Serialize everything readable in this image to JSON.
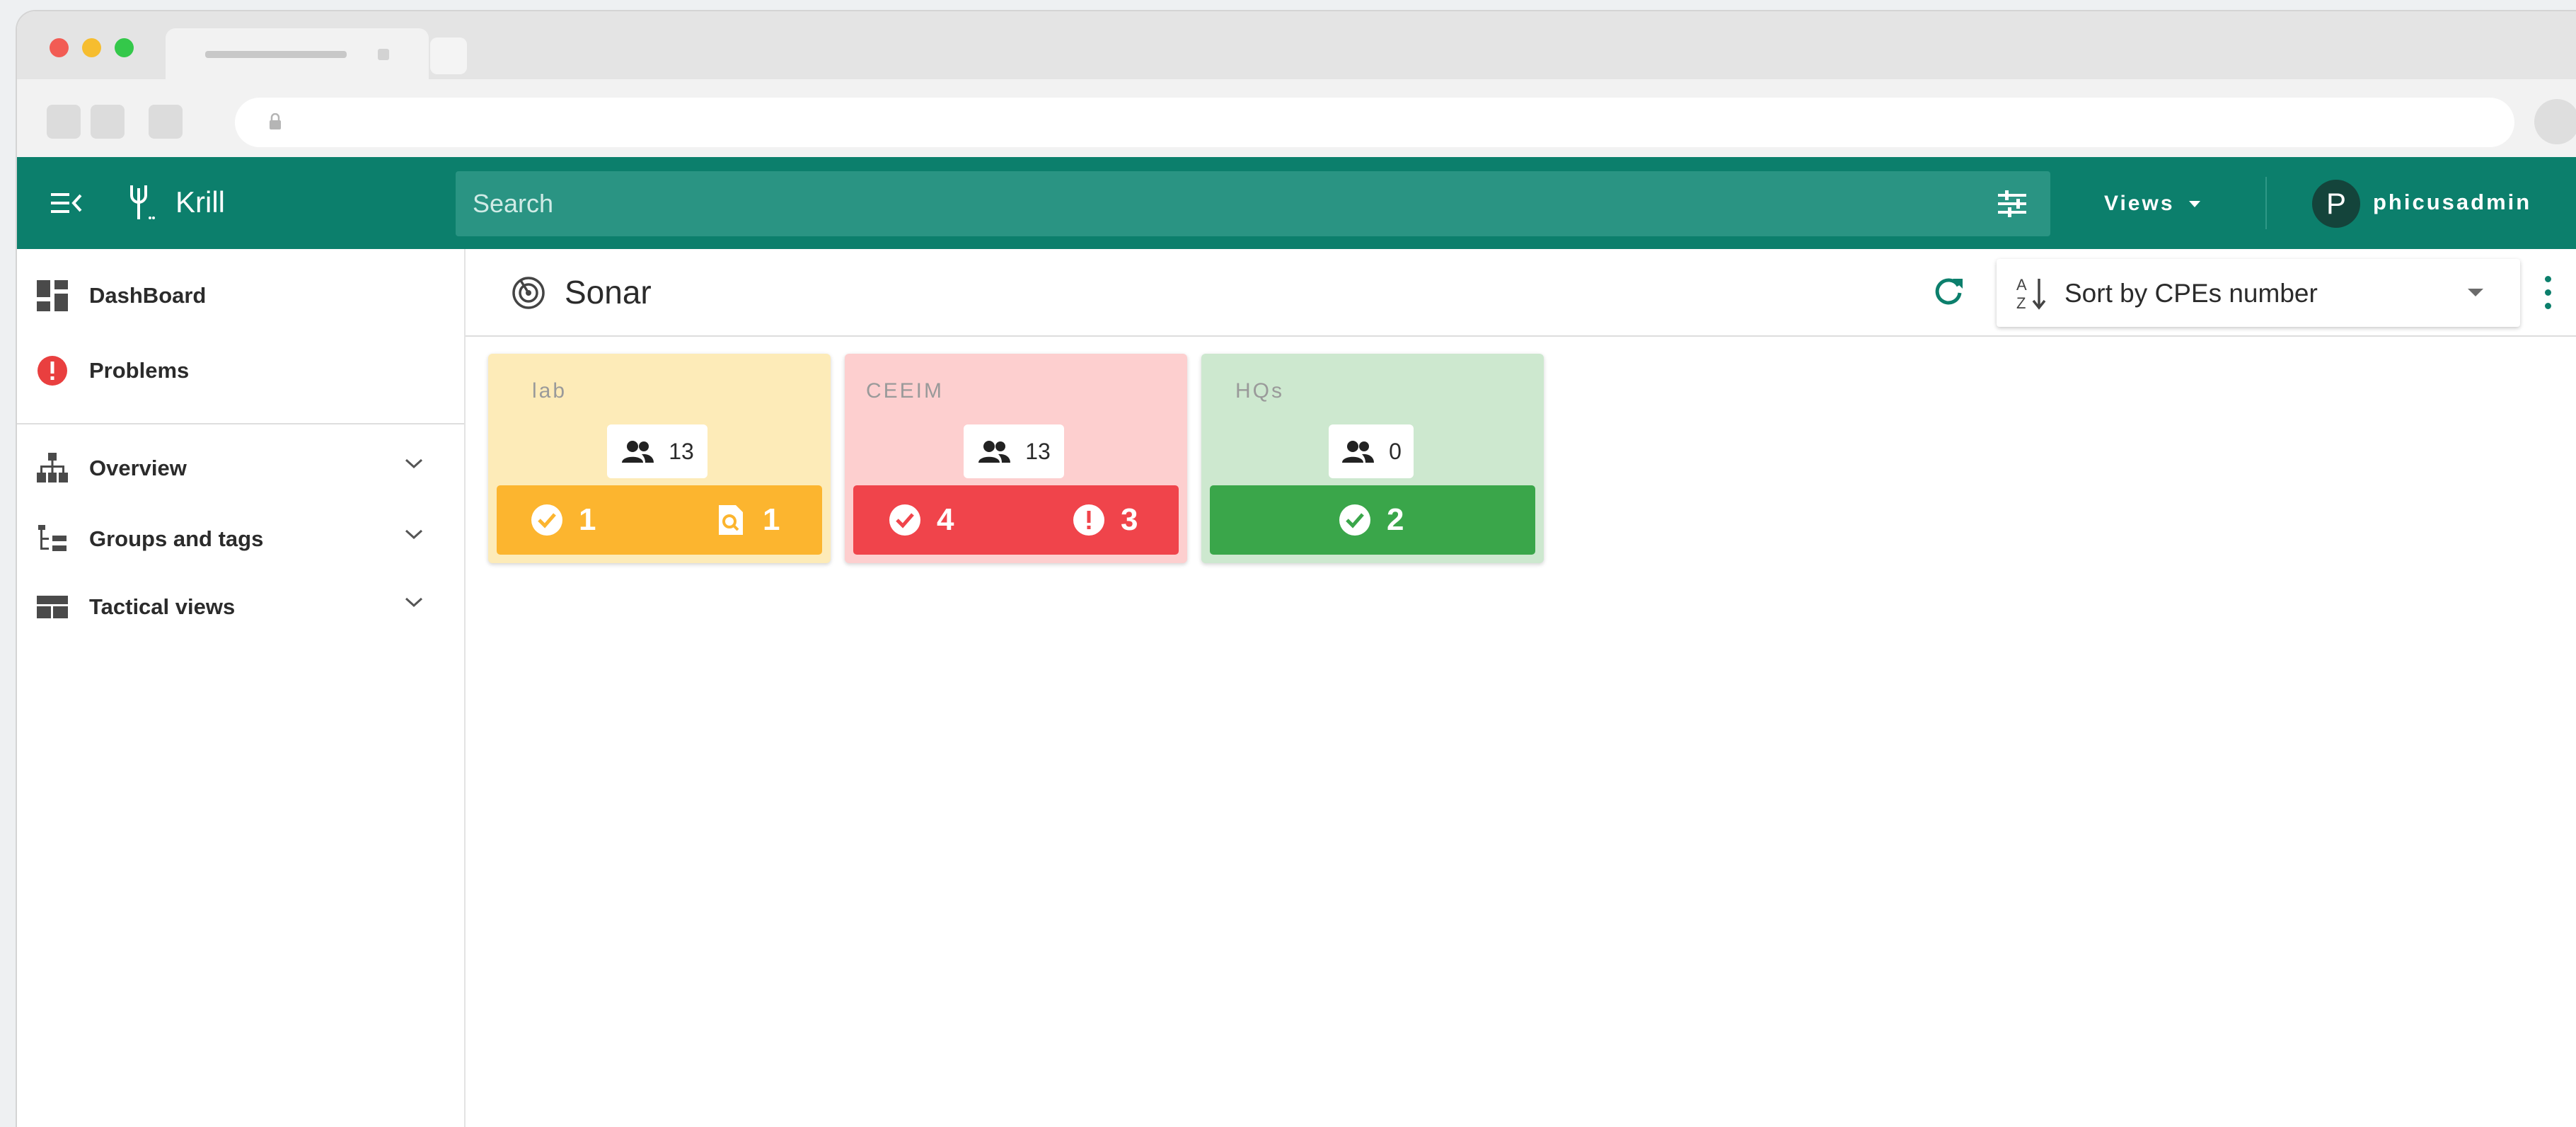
{
  "colors": {
    "primary": "#0c7f6c",
    "lab_bg": "#fdebb8",
    "lab_bar": "#fcb52f",
    "ceeim_bg": "#fdcfcf",
    "ceeim_bar": "#f0444b",
    "hqs_bg": "#cde8cf",
    "hqs_bar": "#3aa64a",
    "problems_icon": "#e93f3f"
  },
  "appbar": {
    "app_name": "Krill",
    "search_placeholder": "Search",
    "views_label": "Views",
    "avatar_initial": "P",
    "username": "phicusadmin"
  },
  "sidebar": {
    "items": [
      {
        "label": "DashBoard",
        "icon": "dashboard-icon"
      },
      {
        "label": "Problems",
        "icon": "alert-icon"
      },
      {
        "label": "Overview",
        "icon": "sitemap-icon",
        "expandable": true
      },
      {
        "label": "Groups and tags",
        "icon": "tree-icon",
        "expandable": true
      },
      {
        "label": "Tactical views",
        "icon": "table-icon",
        "expandable": true
      }
    ]
  },
  "page": {
    "title": "Sonar",
    "sort": {
      "label": "Sort by CPEs number"
    }
  },
  "groups": [
    {
      "name": "lab",
      "cpes": "13",
      "statuses": [
        {
          "icon": "check-circle-icon",
          "count": "1"
        },
        {
          "icon": "search-doc-icon",
          "count": "1"
        }
      ]
    },
    {
      "name": "CEEIM",
      "cpes": "13",
      "statuses": [
        {
          "icon": "check-circle-icon",
          "count": "4"
        },
        {
          "icon": "alert-icon",
          "count": "3"
        }
      ]
    },
    {
      "name": "HQs",
      "cpes": "0",
      "statuses": [
        {
          "icon": "check-circle-icon",
          "count": "2"
        }
      ]
    }
  ]
}
